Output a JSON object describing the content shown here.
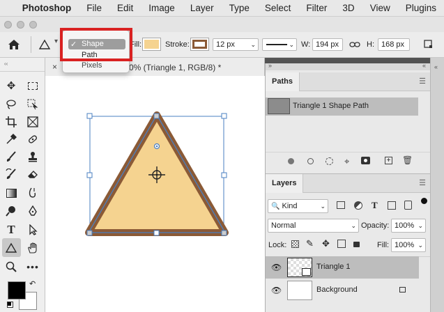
{
  "menubar": {
    "apple_glyph": "",
    "app_name": "Photoshop",
    "items": [
      "File",
      "Edit",
      "Image",
      "Layer",
      "Type",
      "Select",
      "Filter",
      "3D",
      "View",
      "Plugins"
    ]
  },
  "options_bar": {
    "mode_dropdown": {
      "options": [
        "Shape",
        "Path",
        "Pixels"
      ],
      "selected": "Shape",
      "check_glyph": "✓"
    },
    "fill_label": "Fill:",
    "fill_color": "#f5d390",
    "stroke_label": "Stroke:",
    "stroke_color": "#8b5a36",
    "stroke_width": "12 px",
    "w_label": "W:",
    "w_value": "194 px",
    "h_label": "H:",
    "h_value": "168 px"
  },
  "document": {
    "tab_close": "×",
    "tab_title": "0% (Triangle 1, RGB/8) *"
  },
  "shape": {
    "fill_color": "#f5d390",
    "stroke_color": "#8b5a36",
    "path_color": "#4a7fc0"
  },
  "paths_panel": {
    "tab": "Paths",
    "rows": [
      {
        "name": "Triangle 1 Shape Path",
        "selected": true
      }
    ]
  },
  "layers_panel": {
    "tab": "Layers",
    "filter_kind": "Kind",
    "blend_mode": "Normal",
    "opacity_label": "Opacity:",
    "opacity_value": "100%",
    "lock_label": "Lock:",
    "fill_label": "Fill:",
    "fill_value": "100%",
    "layers": [
      {
        "name": "Triangle 1",
        "selected": true,
        "locked": false
      },
      {
        "name": "Background",
        "selected": false,
        "locked": true
      }
    ]
  },
  "colors": {
    "foreground": "#000000",
    "background": "#ffffff",
    "highlight_box": "#d92222"
  }
}
